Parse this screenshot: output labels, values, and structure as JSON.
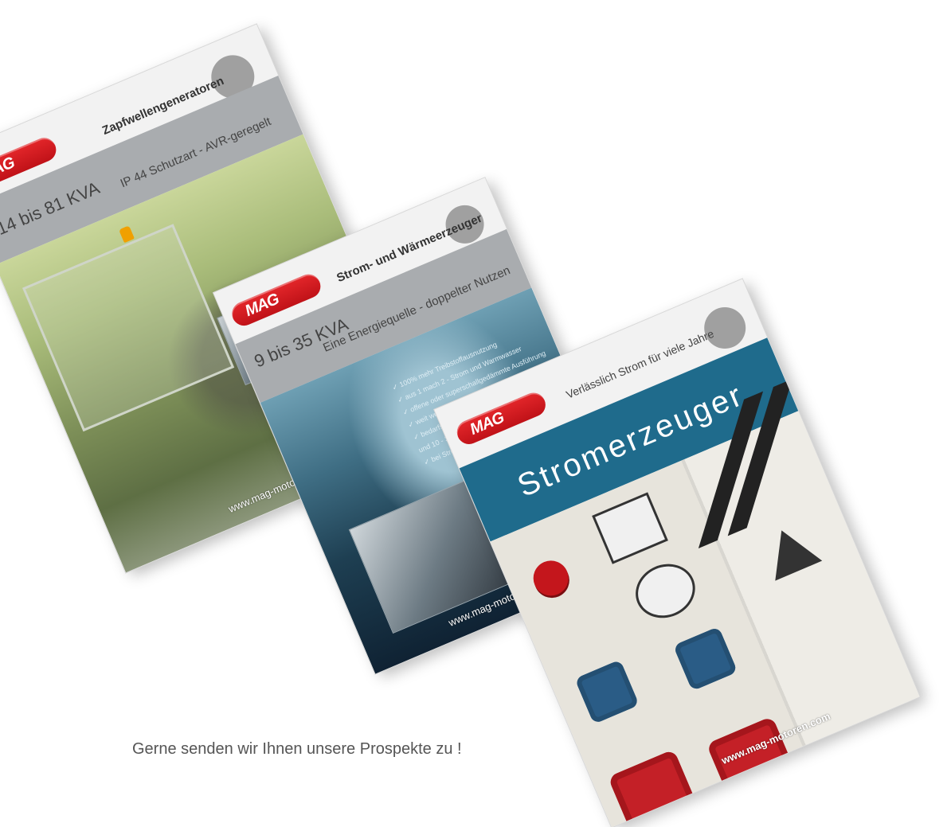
{
  "brochures": [
    {
      "logo": "MAG",
      "heading": "Zapfwellengeneratoren",
      "range": "14 bis 81 KVA",
      "subtitle": "IP 44 Schutzart - AVR-geregelt",
      "url": "www.mag-motoren.com"
    },
    {
      "logo": "MAG",
      "heading": "Strom- und Wärmeerzeuger",
      "range": "9 bis 35 KVA",
      "subtitle": "Eine Energiequelle - doppelter Nutzen",
      "bullets": [
        "✓ 100% mehr Treibstoffausnutzung",
        "✓ aus 1 mach 2 - Strom und Warmwasser",
        "✓ offene oder superschallgedämmte Ausführung",
        "✓ weit weg vom Netz - unabhängig",
        "✓ bedarfsorientierte Leistung",
        "   und 10 - 37 kW thermische Leistung",
        "✓ bei Stromausfall mit Strom"
      ],
      "url": "www.mag-motoren.com"
    },
    {
      "logo": "MAG",
      "tagline": "Verlässlich Strom für viele Jahre",
      "title": "Stromerzeuger",
      "url": "www.mag-motoren.com"
    }
  ],
  "caption": "Gerne senden wir Ihnen unsere Prospekte zu !"
}
